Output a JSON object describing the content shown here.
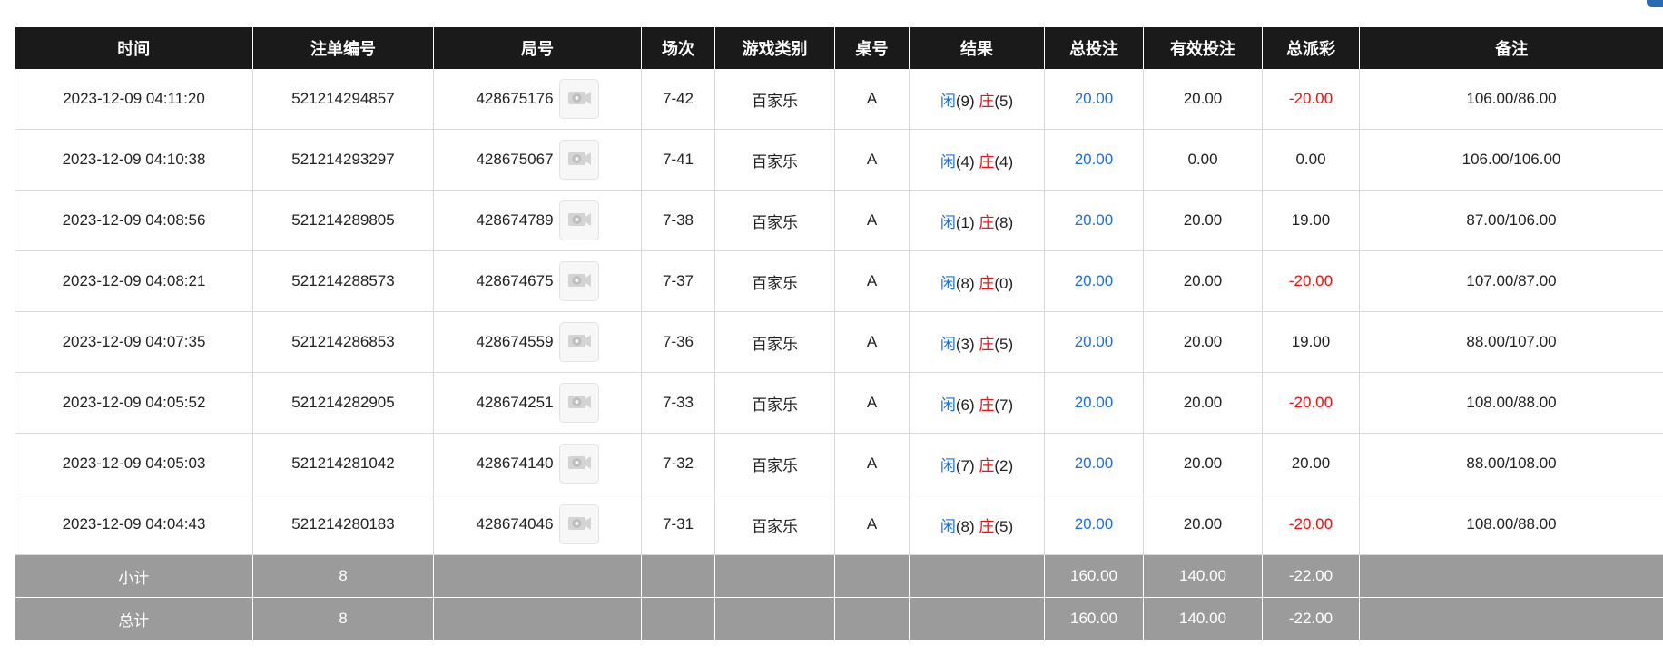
{
  "headers": [
    "时间",
    "注单编号",
    "局号",
    "场次",
    "游戏类别",
    "桌号",
    "结果",
    "总投注",
    "有效投注",
    "总派彩",
    "备注"
  ],
  "result_labels": {
    "player": "闲",
    "banker": "庄"
  },
  "rows": [
    {
      "time": "2023-12-09 04:11:20",
      "bet_id": "521214294857",
      "round_id": "428675176",
      "session": "7-42",
      "game": "百家乐",
      "table": "A",
      "player": "(9)",
      "banker": "(5)",
      "total_bet": "20.00",
      "valid_bet": "20.00",
      "payout": "-20.00",
      "payout_negative": true,
      "note": "106.00/86.00"
    },
    {
      "time": "2023-12-09 04:10:38",
      "bet_id": "521214293297",
      "round_id": "428675067",
      "session": "7-41",
      "game": "百家乐",
      "table": "A",
      "player": "(4)",
      "banker": "(4)",
      "total_bet": "20.00",
      "valid_bet": "0.00",
      "payout": "0.00",
      "payout_negative": false,
      "note": "106.00/106.00"
    },
    {
      "time": "2023-12-09 04:08:56",
      "bet_id": "521214289805",
      "round_id": "428674789",
      "session": "7-38",
      "game": "百家乐",
      "table": "A",
      "player": "(1)",
      "banker": "(8)",
      "total_bet": "20.00",
      "valid_bet": "20.00",
      "payout": "19.00",
      "payout_negative": false,
      "note": "87.00/106.00"
    },
    {
      "time": "2023-12-09 04:08:21",
      "bet_id": "521214288573",
      "round_id": "428674675",
      "session": "7-37",
      "game": "百家乐",
      "table": "A",
      "player": "(8)",
      "banker": "(0)",
      "total_bet": "20.00",
      "valid_bet": "20.00",
      "payout": "-20.00",
      "payout_negative": true,
      "note": "107.00/87.00"
    },
    {
      "time": "2023-12-09 04:07:35",
      "bet_id": "521214286853",
      "round_id": "428674559",
      "session": "7-36",
      "game": "百家乐",
      "table": "A",
      "player": "(3)",
      "banker": "(5)",
      "total_bet": "20.00",
      "valid_bet": "20.00",
      "payout": "19.00",
      "payout_negative": false,
      "note": "88.00/107.00"
    },
    {
      "time": "2023-12-09 04:05:52",
      "bet_id": "521214282905",
      "round_id": "428674251",
      "session": "7-33",
      "game": "百家乐",
      "table": "A",
      "player": "(6)",
      "banker": "(7)",
      "total_bet": "20.00",
      "valid_bet": "20.00",
      "payout": "-20.00",
      "payout_negative": true,
      "note": "108.00/88.00"
    },
    {
      "time": "2023-12-09 04:05:03",
      "bet_id": "521214281042",
      "round_id": "428674140",
      "session": "7-32",
      "game": "百家乐",
      "table": "A",
      "player": "(7)",
      "banker": "(2)",
      "total_bet": "20.00",
      "valid_bet": "20.00",
      "payout": "20.00",
      "payout_negative": false,
      "note": "88.00/108.00"
    },
    {
      "time": "2023-12-09 04:04:43",
      "bet_id": "521214280183",
      "round_id": "428674046",
      "session": "7-31",
      "game": "百家乐",
      "table": "A",
      "player": "(8)",
      "banker": "(5)",
      "total_bet": "20.00",
      "valid_bet": "20.00",
      "payout": "-20.00",
      "payout_negative": true,
      "note": "108.00/88.00"
    }
  ],
  "subtotal": {
    "label": "小计",
    "count": "8",
    "total_bet": "160.00",
    "valid_bet": "140.00",
    "payout": "-22.00"
  },
  "grandtotal": {
    "label": "总计",
    "count": "8",
    "total_bet": "160.00",
    "valid_bet": "140.00",
    "payout": "-22.00"
  },
  "icons": {
    "replay": "video-replay-icon"
  },
  "colors": {
    "header_bg": "#1a1a1a",
    "summary_bg": "#9b9b9b",
    "blue": "#1f6fe0",
    "red": "#ee1111"
  }
}
